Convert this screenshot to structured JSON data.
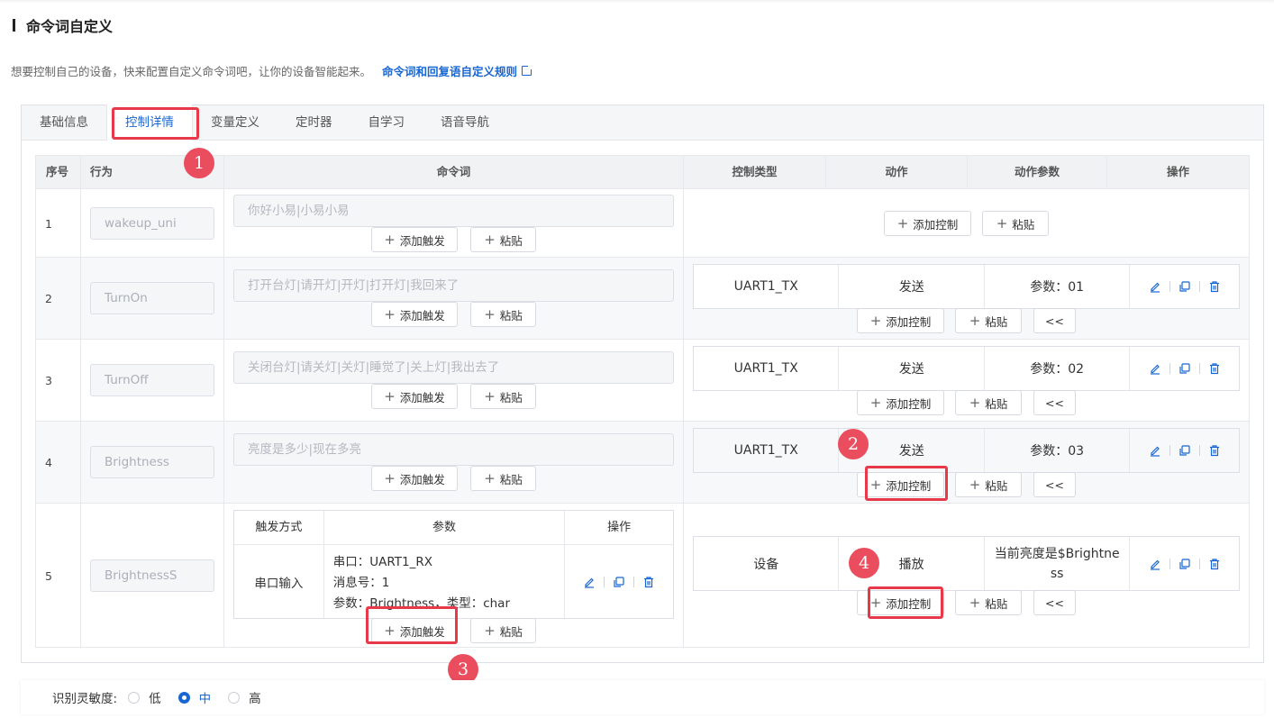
{
  "section": {
    "title": "命令词自定义"
  },
  "intro": {
    "text": "想要控制自己的设备，快来配置自定义命令词吧，让你的设备智能起来。",
    "link": "命令词和回复语自定义规则"
  },
  "tabs": [
    "基础信息",
    "控制详情",
    "变量定义",
    "定时器",
    "自学习",
    "语音导航"
  ],
  "table": {
    "headers": {
      "index": "序号",
      "behavior": "行为",
      "command": "命令词",
      "control_type": "控制类型",
      "action": "动作",
      "action_params": "动作参数",
      "ops": "操作"
    },
    "add_trigger": "添加触发",
    "paste": "粘贴",
    "add_control": "添加控制",
    "collapse": "<<",
    "rows": [
      {
        "index": "1",
        "behavior": "wakeup_uni",
        "command": "你好小易|小易小易"
      },
      {
        "index": "2",
        "behavior": "TurnOn",
        "command": "打开台灯|请开灯|开灯|打开灯|我回来了",
        "control_type": "UART1_TX",
        "action": "发送",
        "param": "参数：01"
      },
      {
        "index": "3",
        "behavior": "TurnOff",
        "command": "关闭台灯|请关灯|关灯|睡觉了|关上灯|我出去了",
        "control_type": "UART1_TX",
        "action": "发送",
        "param": "参数：02"
      },
      {
        "index": "4",
        "behavior": "Brightness",
        "command": "亮度是多少|现在多亮",
        "control_type": "UART1_TX",
        "action": "发送",
        "param": "参数：03"
      },
      {
        "index": "5",
        "behavior": "BrightnessS",
        "control_type": "设备",
        "action": "播放",
        "param": "当前亮度是$Brightness"
      }
    ],
    "trigger_table": {
      "headers": {
        "mode": "触发方式",
        "params": "参数",
        "ops": "操作"
      },
      "mode": "串口输入",
      "lines": [
        "串口：UART1_RX",
        "消息号：1",
        "参数：Brightness，类型：char"
      ]
    }
  },
  "badges": [
    "1",
    "2",
    "3",
    "4"
  ],
  "sensitivity": {
    "label": "识别灵敏度:",
    "options": [
      "低",
      "中",
      "高"
    ],
    "selected": "中"
  },
  "colors": {
    "accent": "#1766d3",
    "highlight": "#e8394a"
  }
}
